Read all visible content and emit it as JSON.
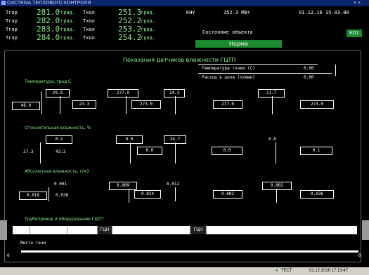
{
  "window": {
    "title": "СИСТЕМА ТЕПЛОВОГО КОНТРОЛЯ"
  },
  "header": {
    "rows": [
      {
        "label": "Tгор",
        "v1": "281.0",
        "u1": "град.",
        "l2": "Tхол",
        "v2": "251.3",
        "u2": "град."
      },
      {
        "label": "Tгор",
        "v1": "282.0",
        "u1": "град.",
        "l2": "Tхол",
        "v2": "252.2",
        "u2": "град."
      },
      {
        "label": "Tгор",
        "v1": "283.0",
        "u1": "град.",
        "l2": "Tхол",
        "v2": "253.2",
        "u2": "град."
      },
      {
        "label": "Tгор",
        "v1": "284.0",
        "u1": "град.",
        "l2": "Tхол",
        "v2": "254.2",
        "u2": "град."
      }
    ],
    "knu_label": "КНУ",
    "knu_value": "352.3 МВт",
    "datetime": "01.12.16 15.03.00",
    "state_label": "Состояние объекта",
    "state_value": "Норма",
    "badge": "К01"
  },
  "main": {
    "title": "Показания датчиков влажности ГЦТП",
    "dew_label": "Температура точки (С)",
    "dew_value": "0.00",
    "flow_label": "Расход в цепи (л/мин)",
    "flow_value": "0.00",
    "sections": [
      "Температура, град С",
      "Относительная влажность, %",
      "Абсолютная влажность, г/м3"
    ],
    "temp_values": [
      "29.0",
      "277.0",
      "24.3",
      "21.7",
      "46.0",
      "23.3",
      "273.0",
      "277.0",
      "273.0"
    ],
    "rh_values": [
      "0.2",
      "0.0",
      "34.7",
      "0.0",
      "37.3",
      "43.3",
      "0.0",
      "0.0",
      "0.1"
    ],
    "ah_values": [
      "0.001",
      "0.009",
      "0.012",
      "0.002",
      "0.018",
      "0.038",
      "0.024",
      "0.002",
      "0.036"
    ],
    "tracker_label": "Трубопровод и оборудование ГЦТП",
    "tracker_cells": [
      "ГЦН",
      "ГЦН"
    ],
    "legend": "Место течи"
  },
  "statusbar": {
    "left_value": "0",
    "right_value": "0",
    "indicator": "ТЕСТ",
    "datetime": "01.12.2016 17:13:47"
  },
  "colors": {
    "green": "#8cf08c",
    "status_green": "#1b8a2e",
    "bg": "#000000",
    "title_bar": "#0a246a"
  }
}
